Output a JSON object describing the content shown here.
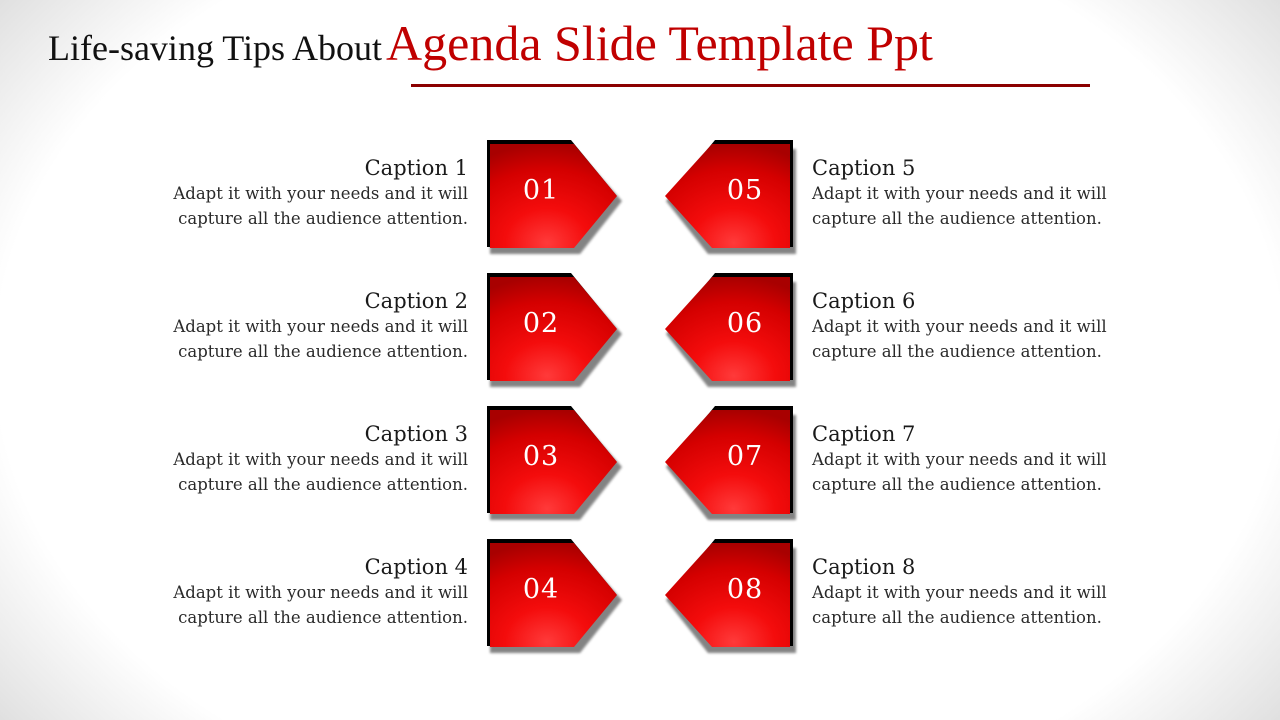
{
  "slide": {
    "title_plain": "Life-saving Tips About",
    "title_accent": "Agenda Slide Template Ppt",
    "accent_color": "#c00000",
    "underline_color": "#8b0000",
    "badge_color": "#ee0000",
    "badge_shadow_color": "#000000"
  },
  "items": [
    {
      "number": "01",
      "caption": "Caption 1",
      "body_line1": "Adapt it with your needs and it will",
      "body_line2": "capture all the audience attention.",
      "side": "left"
    },
    {
      "number": "02",
      "caption": "Caption 2",
      "body_line1": "Adapt it with your needs and it will",
      "body_line2": "capture all the audience attention.",
      "side": "left"
    },
    {
      "number": "03",
      "caption": "Caption 3",
      "body_line1": "Adapt it with your needs and it will",
      "body_line2": "capture all the audience attention.",
      "side": "left"
    },
    {
      "number": "04",
      "caption": "Caption 4",
      "body_line1": "Adapt it with your needs and it will",
      "body_line2": "capture all the audience attention.",
      "side": "left"
    },
    {
      "number": "05",
      "caption": "Caption 5",
      "body_line1": "Adapt it with your needs and it will",
      "body_line2": "capture all the audience attention.",
      "side": "right"
    },
    {
      "number": "06",
      "caption": "Caption 6",
      "body_line1": "Adapt it with your needs and it will",
      "body_line2": "capture all the audience attention.",
      "side": "right"
    },
    {
      "number": "07",
      "caption": "Caption 7",
      "body_line1": "Adapt it with your needs and it will",
      "body_line2": "capture all the audience attention.",
      "side": "right"
    },
    {
      "number": "08",
      "caption": "Caption 8",
      "body_line1": "Adapt it with your needs and it will",
      "body_line2": "capture all the audience attention.",
      "side": "right"
    }
  ]
}
